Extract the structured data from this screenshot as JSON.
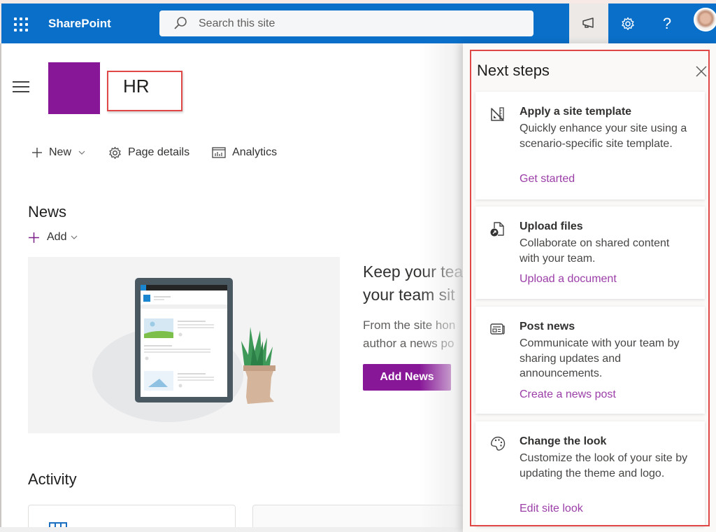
{
  "suitebar": {
    "app_name": "SharePoint",
    "search_placeholder": "Search this site",
    "icons": [
      "waffle-icon",
      "search-icon",
      "megaphone-icon",
      "gear-icon",
      "help-icon",
      "avatar"
    ],
    "help_glyph": "?",
    "colors": {
      "bar": "#0a6fc9",
      "active_button": "#ece9e7"
    }
  },
  "site": {
    "title": "HR",
    "logo_color": "#881798"
  },
  "command_bar": {
    "new_label": "New",
    "page_details_label": "Page details",
    "analytics_label": "Analytics"
  },
  "news": {
    "heading": "News",
    "add_label": "Add",
    "promo_title_line1": "Keep your tea",
    "promo_title_line2": "your team sit",
    "promo_text_line1": "From the site hon",
    "promo_text_line2": "author a news po",
    "add_news_button": "Add News",
    "accent": "#881798"
  },
  "activity": {
    "heading": "Activity"
  },
  "panel": {
    "title": "Next steps",
    "close_glyph": "×",
    "steps": [
      {
        "icon": "site-template-icon",
        "title": "Apply a site template",
        "description": "Quickly enhance your site using a scenario-specific site template.",
        "link": "Get started"
      },
      {
        "icon": "upload-file-icon",
        "title": "Upload files",
        "description": "Collaborate on shared content with your team.",
        "link": "Upload a document"
      },
      {
        "icon": "news-icon",
        "title": "Post news",
        "description": "Communicate with your team by sharing updates and announcements.",
        "link": "Create a news post"
      },
      {
        "icon": "palette-icon",
        "title": "Change the look",
        "description": "Customize the look of your site by updating the theme and logo.",
        "link": "Edit site look"
      }
    ],
    "link_color": "#9b3ea8",
    "highlight_color": "#e04848"
  }
}
